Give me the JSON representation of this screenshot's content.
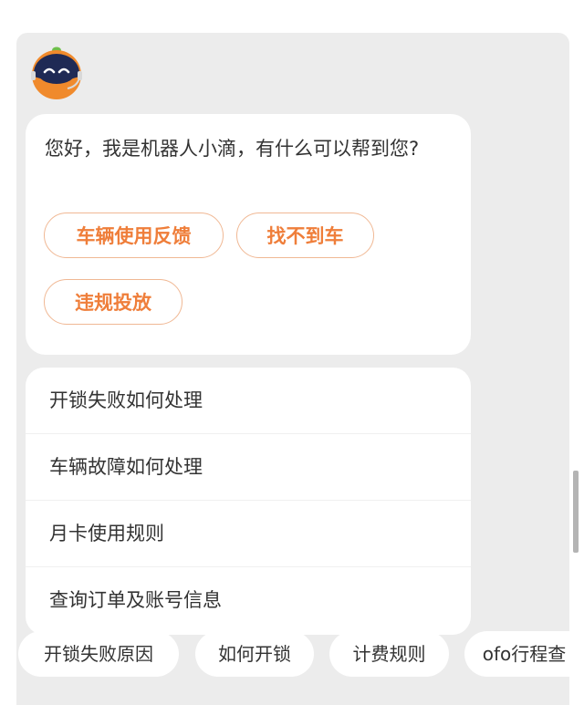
{
  "bot": {
    "avatar_icon": "robot-avatar-icon",
    "greeting": "您好，我是机器人小滴，有什么可以帮到您?"
  },
  "quick_actions": [
    {
      "label": "车辆使用反馈"
    },
    {
      "label": "找不到车"
    },
    {
      "label": "违规投放"
    }
  ],
  "faq": [
    {
      "label": "开锁失败如何处理"
    },
    {
      "label": "车辆故障如何处理"
    },
    {
      "label": "月卡使用规则"
    },
    {
      "label": "查询订单及账号信息"
    }
  ],
  "chips": [
    {
      "label": "开锁失败原因"
    },
    {
      "label": "如何开锁"
    },
    {
      "label": "计费规则"
    },
    {
      "label": "ofo行程查"
    }
  ],
  "colors": {
    "accent": "#ef7e3a",
    "panel_bg": "#ececec",
    "card_bg": "#ffffff"
  }
}
